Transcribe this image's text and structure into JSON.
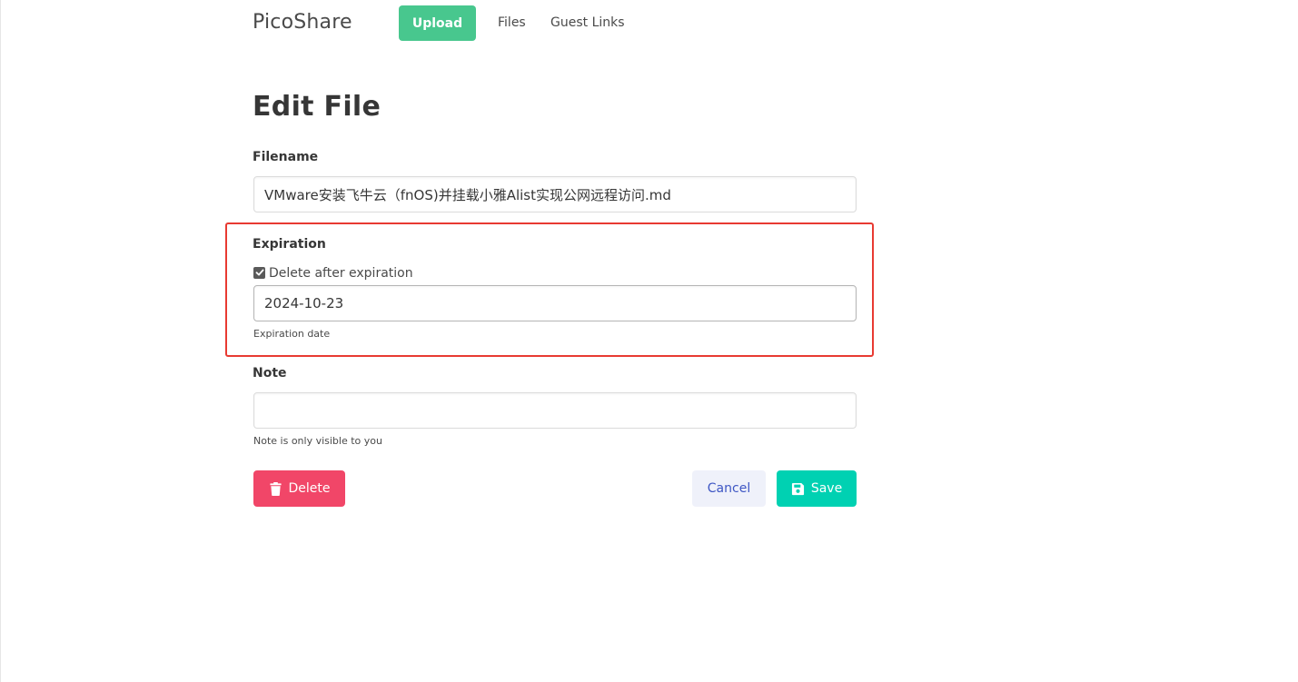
{
  "nav": {
    "brand": "PicoShare",
    "upload_label": "Upload",
    "files_label": "Files",
    "guest_links_label": "Guest Links"
  },
  "page": {
    "title": "Edit File"
  },
  "form": {
    "filename": {
      "label": "Filename",
      "value": "VMware安装飞牛云（fnOS)并挂载小雅Alist实现公网远程访问.md"
    },
    "expiration": {
      "label": "Expiration",
      "checkbox_label": "Delete after expiration",
      "checked": true,
      "date_value": "2024-10-23",
      "help": "Expiration date"
    },
    "note": {
      "label": "Note",
      "value": "",
      "help": "Note is only visible to you"
    }
  },
  "actions": {
    "delete_label": "Delete",
    "cancel_label": "Cancel",
    "save_label": "Save"
  },
  "colors": {
    "upload": "#48c78e",
    "delete": "#f14668",
    "save": "#00d1b2",
    "cancel_bg": "#eff1fa",
    "cancel_text": "#3e56c4",
    "highlight": "#e83a32"
  },
  "icons": {
    "delete": "trash-icon",
    "save": "floppy-disk-icon",
    "checkbox": "checkmark-icon"
  }
}
